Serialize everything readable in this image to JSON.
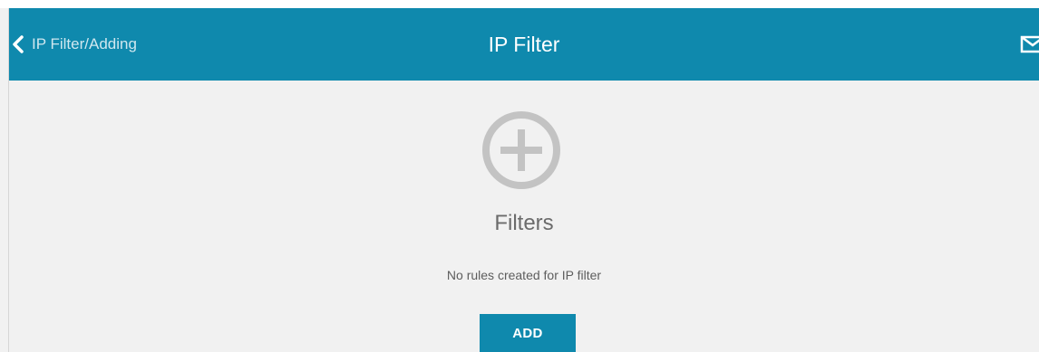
{
  "header": {
    "back_label": "IP Filter/Adding",
    "title": "IP Filter",
    "icons": {
      "back": "chevron-left-icon",
      "mail": "mail-icon"
    }
  },
  "main": {
    "section_title": "Filters",
    "empty_message": "No rules created for IP filter",
    "add_label": "ADD",
    "icons": {
      "add": "plus-circle-icon"
    }
  },
  "colors": {
    "accent": "#0f89ad",
    "background": "#f1f1f1",
    "icon_gray": "#c3c3c3",
    "text_gray": "#6b6b6b"
  }
}
